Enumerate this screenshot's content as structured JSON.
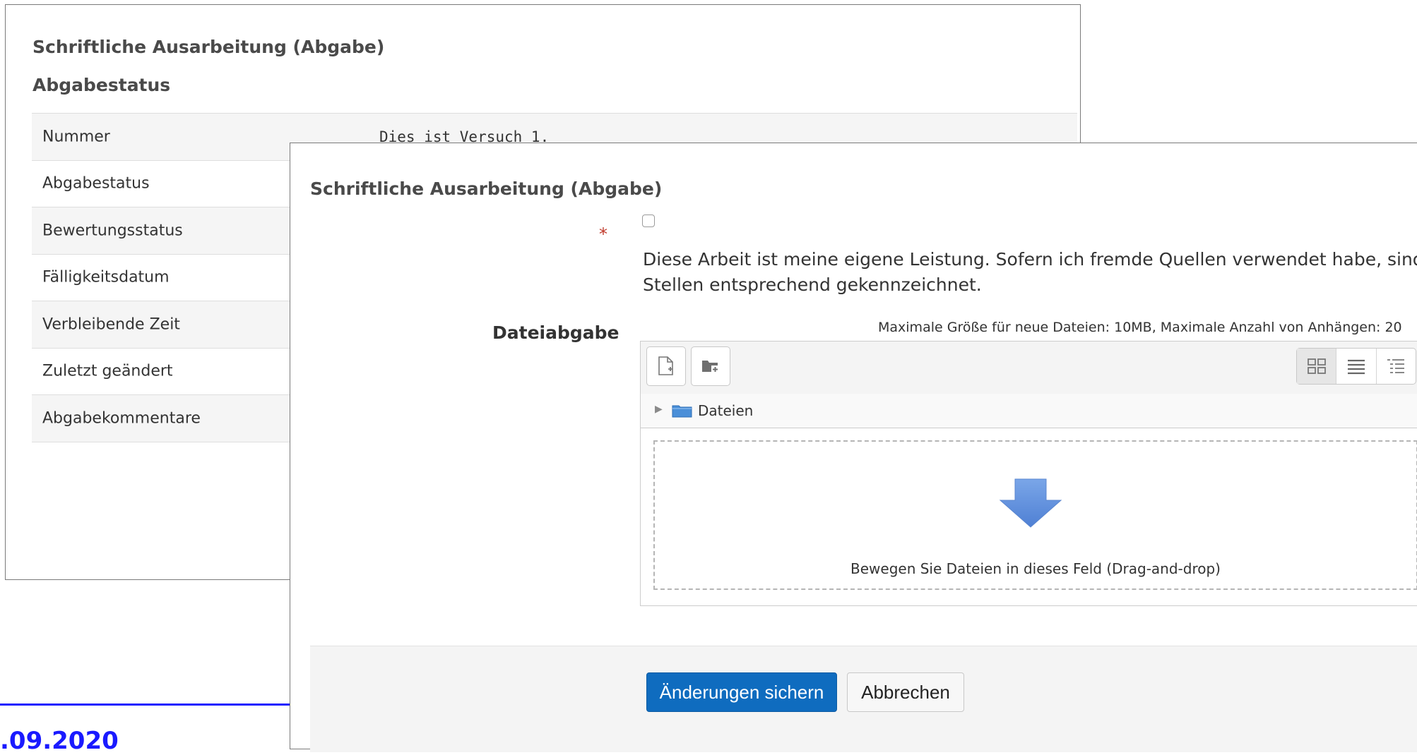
{
  "status_panel": {
    "title": "Schriftliche Ausarbeitung (Abgabe)",
    "subtitle": "Abgabestatus",
    "rows": [
      {
        "label": "Nummer",
        "value": "Dies ist Versuch 1."
      },
      {
        "label": "Abgabestatus",
        "value": ""
      },
      {
        "label": "Bewertungsstatus",
        "value": ""
      },
      {
        "label": "Fälligkeitsdatum",
        "value": ""
      },
      {
        "label": "Verbleibende Zeit",
        "value": ""
      },
      {
        "label": "Zuletzt geändert",
        "value": ""
      },
      {
        "label": "Abgabekommentare",
        "value": ""
      }
    ]
  },
  "background": {
    "date_fragment": ".09.2020",
    "accent_color": "#1a1aff"
  },
  "form": {
    "title": "Schriftliche Ausarbeitung (Abgabe)",
    "required_marker": "*",
    "declaration_checked": false,
    "declaration_text": "Diese Arbeit ist meine eigene Leistung. Sofern ich fremde Quellen verwendet habe, sind die Stellen entsprechend gekennzeichnet.",
    "file_label": "Dateiabgabe",
    "file_limits": "Maximale Größe für neue Dateien: 10MB, Maximale Anzahl von Anhängen: 20",
    "filepicker": {
      "toolbar_icons": [
        "add-file-icon",
        "create-folder-icon"
      ],
      "view_icons": [
        "icon-view-icon",
        "list-view-icon",
        "tree-view-icon"
      ],
      "path_label": "Dateien",
      "drop_text": "Bewegen Sie Dateien in dieses Feld (Drag-and-drop)"
    },
    "save_label": "Änderungen sichern",
    "cancel_label": "Abbrechen",
    "primary_color": "#0f6cbf"
  }
}
